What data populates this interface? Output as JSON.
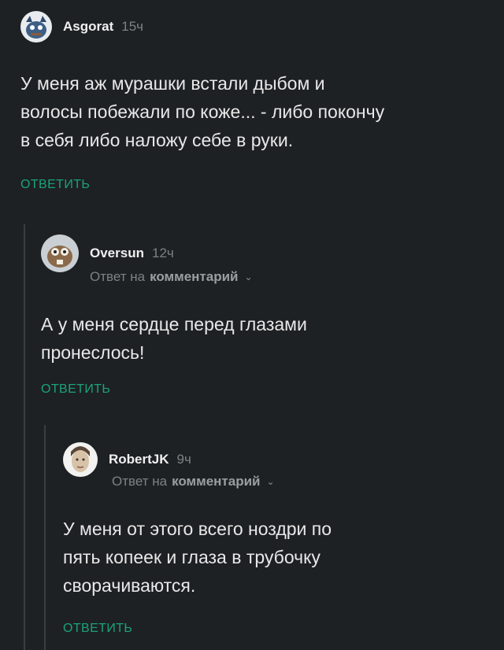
{
  "comments": [
    {
      "author": "Asgorat",
      "time": "15ч",
      "text_lines": [
        "У меня аж мурашки встали дыбом и",
        "волосы побежали по коже... - либо покончу",
        "в себя либо наложу себе в руки."
      ],
      "reply_label": "ОТВЕТИТЬ"
    },
    {
      "author": "Oversun",
      "time": "12ч",
      "reply_to_prefix": "Ответ на",
      "reply_to_link": "комментарий",
      "text_lines": [
        "А у меня сердце перед глазами",
        "пронеслось!"
      ],
      "reply_label": "ОТВЕТИТЬ"
    },
    {
      "author": "RobertJK",
      "time": "9ч",
      "reply_to_prefix": "Ответ на",
      "reply_to_link": "комментарий",
      "text_lines": [
        "У меня от этого всего ноздри по",
        "пять копеек и глаза в трубочку",
        "сворачиваются."
      ],
      "reply_label": "ОТВЕТИТЬ"
    }
  ],
  "colors": {
    "background": "#1e2124",
    "accent": "#1aa37a",
    "muted": "#7d8185"
  }
}
